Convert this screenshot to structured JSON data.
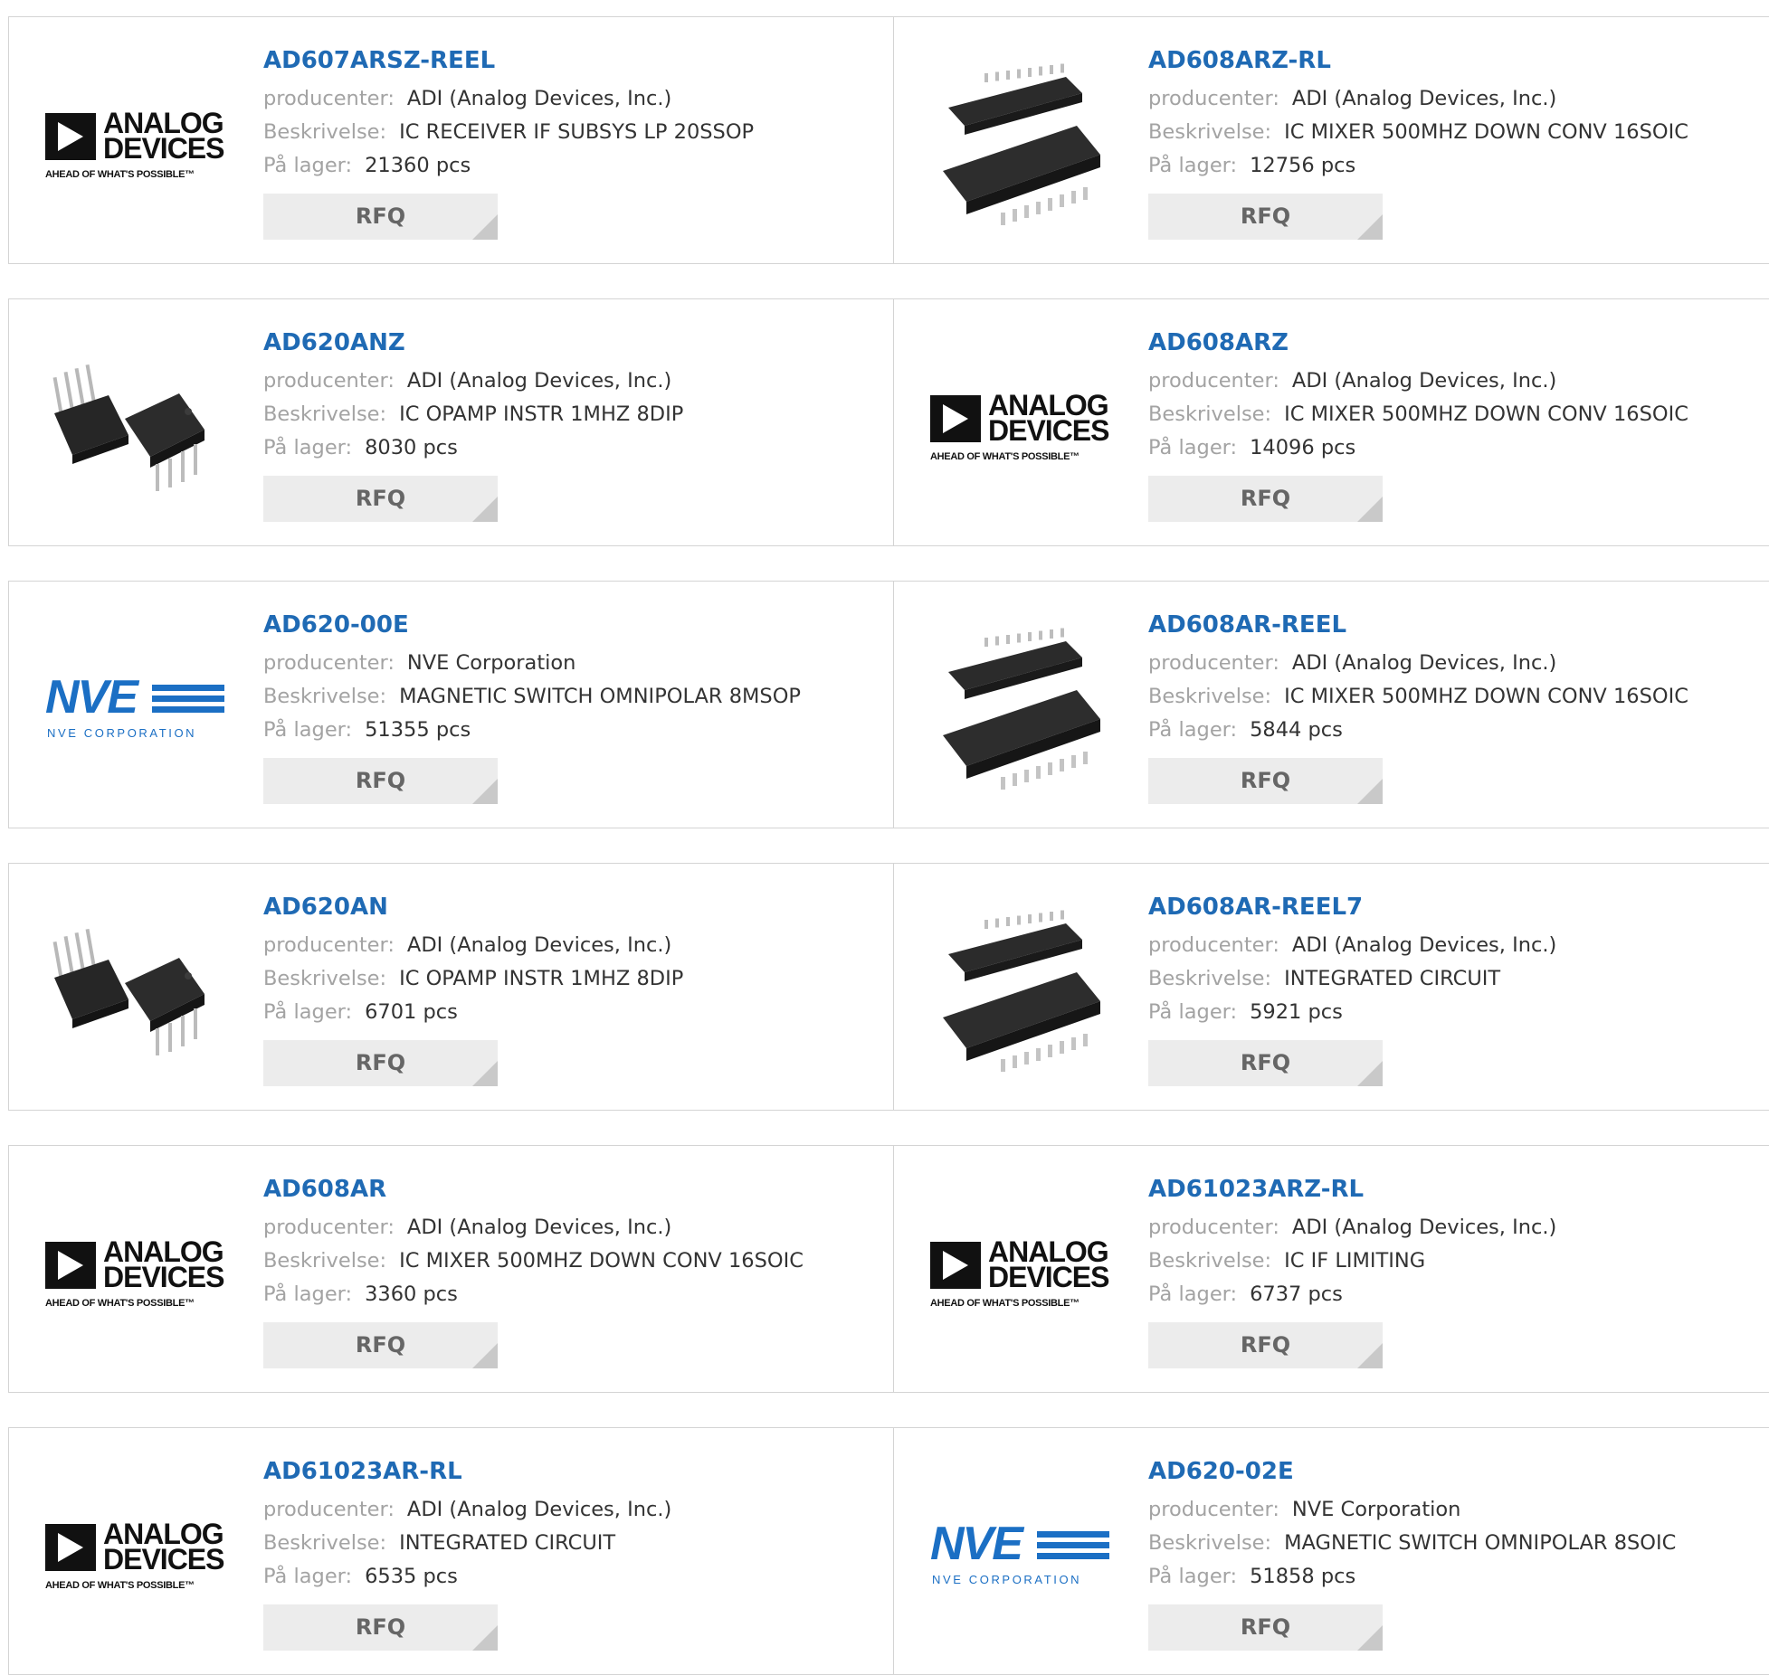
{
  "labels": {
    "manufacturer": "producenter:",
    "description": "Beskrivelse:",
    "stock": "På lager:",
    "rfq": "RFQ"
  },
  "logo_text": {
    "adi_line1": "ANALOG",
    "adi_line2": "DEVICES",
    "adi_tagline": "AHEAD OF WHAT'S POSSIBLE™",
    "nve_word": "NVE",
    "nve_sub": "NVE CORPORATION"
  },
  "products": [
    {
      "part": "AD607ARSZ-REEL",
      "manufacturer": "ADI (Analog Devices, Inc.)",
      "description": "IC RECEIVER IF SUBSYS LP 20SSOP",
      "stock": "21360 pcs",
      "image": "analog-devices-logo"
    },
    {
      "part": "AD608ARZ-RL",
      "manufacturer": "ADI (Analog Devices, Inc.)",
      "description": "IC MIXER 500MHZ DOWN CONV 16SOIC",
      "stock": "12756 pcs",
      "image": "soic-chip-photo"
    },
    {
      "part": "AD620ANZ",
      "manufacturer": "ADI (Analog Devices, Inc.)",
      "description": "IC OPAMP INSTR 1MHZ 8DIP",
      "stock": "8030 pcs",
      "image": "dip-chip-photo"
    },
    {
      "part": "AD608ARZ",
      "manufacturer": "ADI (Analog Devices, Inc.)",
      "description": "IC MIXER 500MHZ DOWN CONV 16SOIC",
      "stock": "14096 pcs",
      "image": "analog-devices-logo"
    },
    {
      "part": "AD620-00E",
      "manufacturer": "NVE Corporation",
      "description": "MAGNETIC SWITCH OMNIPOLAR 8MSOP",
      "stock": "51355 pcs",
      "image": "nve-logo"
    },
    {
      "part": "AD608AR-REEL",
      "manufacturer": "ADI (Analog Devices, Inc.)",
      "description": "IC MIXER 500MHZ DOWN CONV 16SOIC",
      "stock": "5844 pcs",
      "image": "soic-chip-photo"
    },
    {
      "part": "AD620AN",
      "manufacturer": "ADI (Analog Devices, Inc.)",
      "description": "IC OPAMP INSTR 1MHZ 8DIP",
      "stock": "6701 pcs",
      "image": "dip-chip-photo"
    },
    {
      "part": "AD608AR-REEL7",
      "manufacturer": "ADI (Analog Devices, Inc.)",
      "description": "INTEGRATED CIRCUIT",
      "stock": "5921 pcs",
      "image": "soic-chip-photo"
    },
    {
      "part": "AD608AR",
      "manufacturer": "ADI (Analog Devices, Inc.)",
      "description": "IC MIXER 500MHZ DOWN CONV 16SOIC",
      "stock": "3360 pcs",
      "image": "analog-devices-logo"
    },
    {
      "part": "AD61023ARZ-RL",
      "manufacturer": "ADI (Analog Devices, Inc.)",
      "description": "IC IF LIMITING",
      "stock": "6737 pcs",
      "image": "analog-devices-logo"
    },
    {
      "part": "AD61023AR-RL",
      "manufacturer": "ADI (Analog Devices, Inc.)",
      "description": "INTEGRATED CIRCUIT",
      "stock": "6535 pcs",
      "image": "analog-devices-logo"
    },
    {
      "part": "AD620-02E",
      "manufacturer": "NVE Corporation",
      "description": "MAGNETIC SWITCH OMNIPOLAR 8SOIC",
      "stock": "51858 pcs",
      "image": "nve-logo"
    }
  ],
  "colors": {
    "part_link": "#1f6ab4",
    "label": "#a3a3a3",
    "border": "#d4d4d4",
    "rfq_bg": "#ececec",
    "nve_blue": "#1b6fc4"
  }
}
